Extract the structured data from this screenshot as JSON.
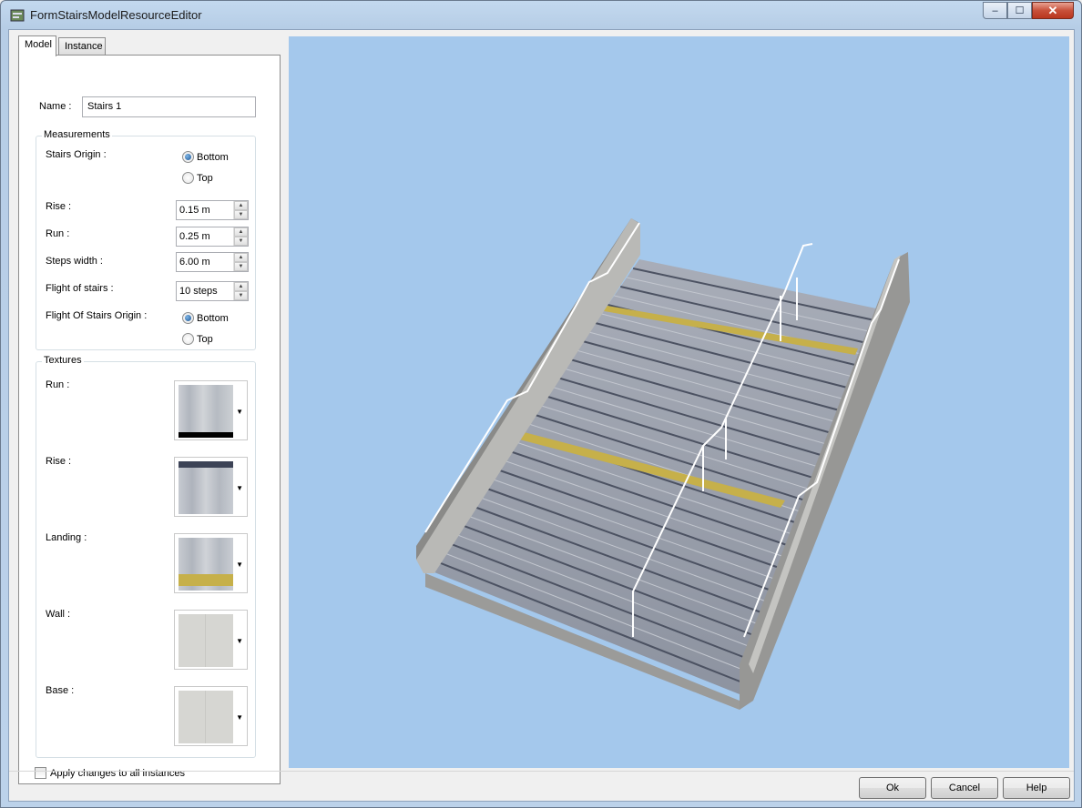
{
  "window": {
    "title": "FormStairsModelResourceEditor",
    "minimize": "‒",
    "maximize": "☐",
    "close": "✕"
  },
  "tabs": {
    "model": "Model",
    "instance": "Instance"
  },
  "form": {
    "name_label": "Name :",
    "name_value": "Stairs 1",
    "measurements": {
      "title": "Measurements",
      "stairs_origin_label": "Stairs Origin :",
      "stairs_origin_options": [
        "Bottom",
        "Top"
      ],
      "stairs_origin_selected": "Bottom",
      "rise_label": "Rise :",
      "rise_value": "0.15 m",
      "run_label": "Run :",
      "run_value": "0.25 m",
      "steps_width_label": "Steps width :",
      "steps_width_value": "6.00 m",
      "flight_label": "Flight of stairs :",
      "flight_value": "10 steps",
      "flight_origin_label": "Flight Of Stairs Origin :",
      "flight_origin_options": [
        "Bottom",
        "Top"
      ],
      "flight_origin_selected": "Bottom"
    },
    "textures": {
      "title": "Textures",
      "run_label": "Run :",
      "rise_label": "Rise :",
      "landing_label": "Landing :",
      "wall_label": "Wall :",
      "base_label": "Base :"
    },
    "apply_all_label": "Apply changes to all instances",
    "apply_all_checked": false
  },
  "buttons": {
    "ok": "Ok",
    "cancel": "Cancel",
    "help": "Help"
  },
  "colors": {
    "viewport_bg": "#a4c8ec",
    "landing_stripe": "#c6b04a"
  }
}
